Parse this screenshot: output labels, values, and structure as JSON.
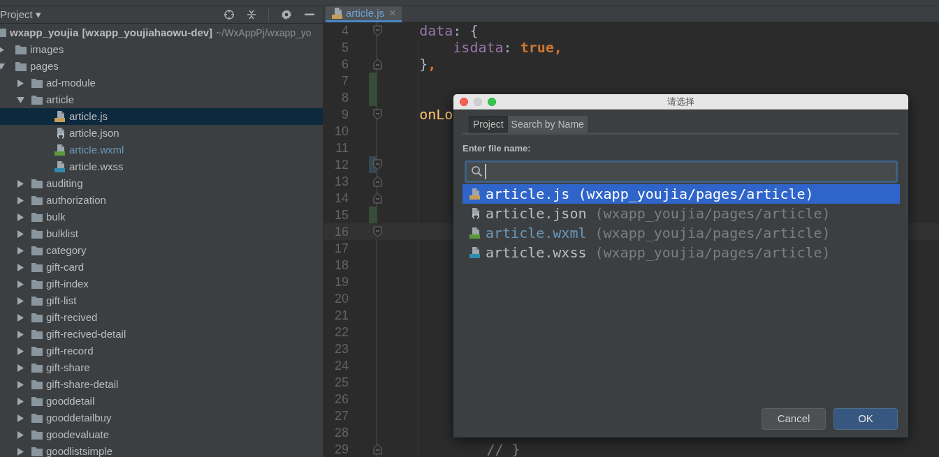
{
  "project_panel": {
    "title": "Project ▾",
    "root": {
      "name": "wxapp_youjia",
      "module": "[wxapp_youjiahaowu-dev]",
      "path": "~/WxAppPj/wxapp_yo"
    },
    "tree": [
      {
        "name": "images",
        "kind": "folder",
        "expanded": false,
        "selected": false
      },
      {
        "name": "pages",
        "kind": "folder",
        "expanded": true,
        "selected": false,
        "children": [
          {
            "name": "ad-module",
            "kind": "folder",
            "expanded": false,
            "selected": false
          },
          {
            "name": "article",
            "kind": "folder",
            "expanded": true,
            "selected": false,
            "children": [
              {
                "name": "article.js",
                "kind": "js",
                "selected": true
              },
              {
                "name": "article.json",
                "kind": "json",
                "selected": false
              },
              {
                "name": "article.wxml",
                "kind": "wxml",
                "selected": false,
                "color": "#6897bb"
              },
              {
                "name": "article.wxss",
                "kind": "wxss",
                "selected": false
              }
            ]
          },
          {
            "name": "auditing",
            "kind": "folder",
            "expanded": false,
            "selected": false
          },
          {
            "name": "authorization",
            "kind": "folder",
            "expanded": false,
            "selected": false
          },
          {
            "name": "bulk",
            "kind": "folder",
            "expanded": false,
            "selected": false
          },
          {
            "name": "bulklist",
            "kind": "folder",
            "expanded": false,
            "selected": false
          },
          {
            "name": "category",
            "kind": "folder",
            "expanded": false,
            "selected": false
          },
          {
            "name": "gift-card",
            "kind": "folder",
            "expanded": false,
            "selected": false
          },
          {
            "name": "gift-index",
            "kind": "folder",
            "expanded": false,
            "selected": false
          },
          {
            "name": "gift-list",
            "kind": "folder",
            "expanded": false,
            "selected": false
          },
          {
            "name": "gift-recived",
            "kind": "folder",
            "expanded": false,
            "selected": false
          },
          {
            "name": "gift-recived-detail",
            "kind": "folder",
            "expanded": false,
            "selected": false
          },
          {
            "name": "gift-record",
            "kind": "folder",
            "expanded": false,
            "selected": false
          },
          {
            "name": "gift-share",
            "kind": "folder",
            "expanded": false,
            "selected": false
          },
          {
            "name": "gift-share-detail",
            "kind": "folder",
            "expanded": false,
            "selected": false
          },
          {
            "name": "gooddetail",
            "kind": "folder",
            "expanded": false,
            "selected": false
          },
          {
            "name": "gooddetailbuy",
            "kind": "folder",
            "expanded": false,
            "selected": false
          },
          {
            "name": "goodevaluate",
            "kind": "folder",
            "expanded": false,
            "selected": false
          },
          {
            "name": "goodlistsimple",
            "kind": "folder",
            "expanded": false,
            "selected": false
          }
        ]
      }
    ]
  },
  "editor": {
    "tabs": [
      {
        "label": "article.js",
        "kind": "js",
        "selected": true,
        "close": "×"
      }
    ],
    "lines": [
      {
        "number": "4",
        "fold_open": true,
        "tokens": [
          {
            "kind": "key",
            "text": "    data"
          },
          {
            "kind": "punct",
            "text": ": {"
          }
        ]
      },
      {
        "number": "5",
        "tokens": [
          {
            "kind": "key",
            "text": "        isdata"
          },
          {
            "kind": "punct",
            "text": ": "
          },
          {
            "kind": "bool",
            "text": "true,"
          }
        ]
      },
      {
        "number": "6",
        "fold_close": true,
        "tokens": [
          {
            "kind": "punct",
            "text": "    }"
          },
          {
            "kind": "bool",
            "text": ","
          }
        ]
      },
      {
        "number": "7",
        "added": true
      },
      {
        "number": "8",
        "added": true
      },
      {
        "number": "9",
        "fold_open": true,
        "tokens": [
          {
            "kind": "fn",
            "text": "    onLo"
          }
        ]
      },
      {
        "number": "10"
      },
      {
        "number": "11"
      },
      {
        "number": "12",
        "fold_open": true,
        "modified": true
      },
      {
        "number": "13",
        "fold_close": true
      },
      {
        "number": "14",
        "fold_close": true
      },
      {
        "number": "15",
        "added": true
      },
      {
        "number": "16",
        "fold_open": true,
        "current": true
      },
      {
        "number": "17"
      },
      {
        "number": "18"
      },
      {
        "number": "19"
      },
      {
        "number": "20"
      },
      {
        "number": "21"
      },
      {
        "number": "22"
      },
      {
        "number": "23"
      },
      {
        "number": "24"
      },
      {
        "number": "25"
      },
      {
        "number": "26"
      },
      {
        "number": "27"
      },
      {
        "number": "28"
      },
      {
        "number": "29",
        "fold_close": true,
        "tokens": [
          {
            "kind": "comment",
            "text": "            // }"
          }
        ]
      }
    ]
  },
  "dialog": {
    "title": "请选择",
    "tabs": [
      {
        "label": "Project",
        "selected": true
      },
      {
        "label": "Search by Name",
        "selected": false
      }
    ],
    "label": "Enter file name:",
    "results": [
      {
        "name": "article.js",
        "kind": "js",
        "path": "(wxapp_youjia/pages/article)",
        "selected": true
      },
      {
        "name": "article.json",
        "kind": "json",
        "path": "(wxapp_youjia/pages/article)",
        "selected": false
      },
      {
        "name": "article.wxml",
        "kind": "wxml",
        "path": "(wxapp_youjia/pages/article)",
        "selected": false,
        "color": "#6897bb"
      },
      {
        "name": "article.wxss",
        "kind": "wxss",
        "path": "(wxapp_youjia/pages/article)",
        "selected": false
      }
    ],
    "buttons": [
      {
        "label": "Cancel",
        "kind": "secondary"
      },
      {
        "label": "OK",
        "kind": "primary"
      }
    ]
  }
}
